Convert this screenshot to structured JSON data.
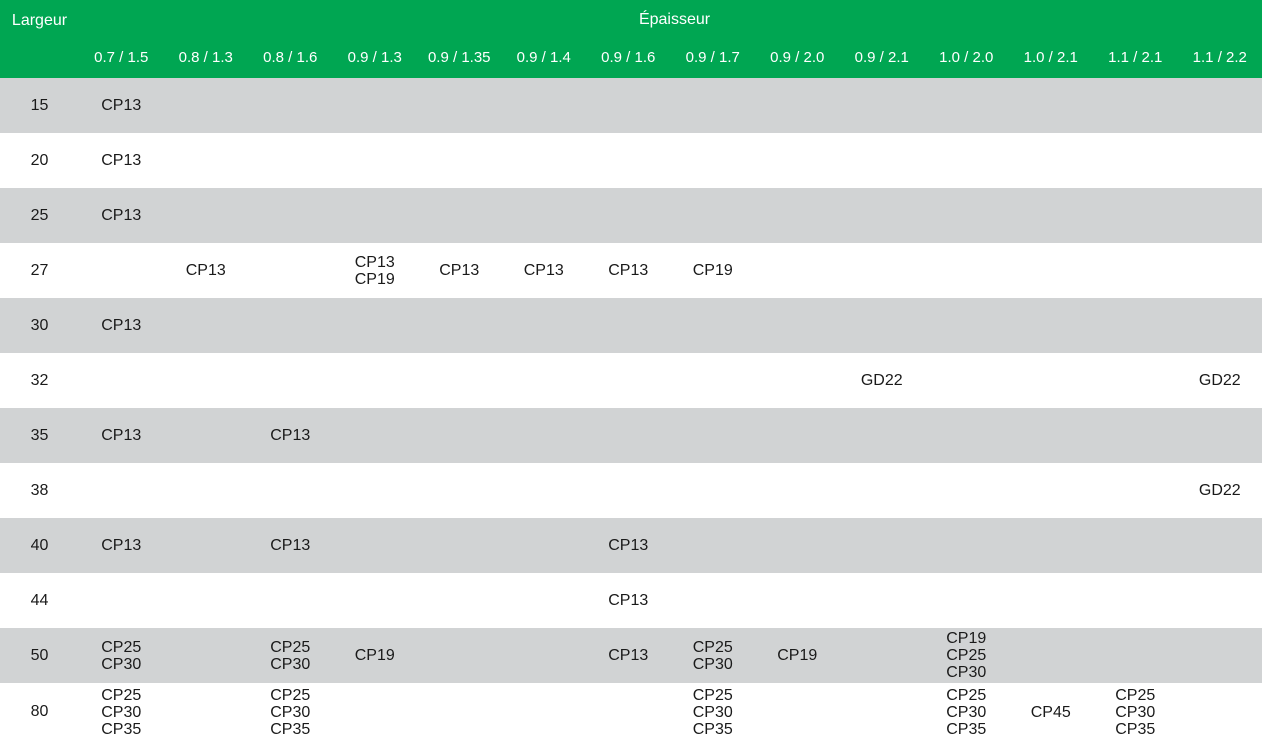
{
  "header": {
    "largeur_label": "Largeur",
    "epaisseur_label": "Épaisseur",
    "thickness_columns": [
      "0.7 / 1.5",
      "0.8 / 1.3",
      "0.8 / 1.6",
      "0.9 / 1.3",
      "0.9 / 1.35",
      "0.9 / 1.4",
      "0.9 / 1.6",
      "0.9 / 1.7",
      "0.9 / 2.0",
      "0.9 / 2.1",
      "1.0 / 2.0",
      "1.0 / 2.1",
      "1.1 / 2.1",
      "1.1 / 2.2"
    ]
  },
  "rows": [
    {
      "width": "15",
      "cells": [
        [
          "CP13"
        ],
        [],
        [],
        [],
        [],
        [],
        [],
        [],
        [],
        [],
        [],
        [],
        [],
        []
      ]
    },
    {
      "width": "20",
      "cells": [
        [
          "CP13"
        ],
        [],
        [],
        [],
        [],
        [],
        [],
        [],
        [],
        [],
        [],
        [],
        [],
        []
      ]
    },
    {
      "width": "25",
      "cells": [
        [
          "CP13"
        ],
        [],
        [],
        [],
        [],
        [],
        [],
        [],
        [],
        [],
        [],
        [],
        [],
        []
      ]
    },
    {
      "width": "27",
      "cells": [
        [],
        [
          "CP13"
        ],
        [],
        [
          "CP13",
          "CP19"
        ],
        [
          "CP13"
        ],
        [
          "CP13"
        ],
        [
          "CP13"
        ],
        [
          "CP19"
        ],
        [],
        [],
        [],
        [],
        [],
        []
      ]
    },
    {
      "width": "30",
      "cells": [
        [
          "CP13"
        ],
        [],
        [],
        [],
        [],
        [],
        [],
        [],
        [],
        [],
        [],
        [],
        [],
        []
      ]
    },
    {
      "width": "32",
      "cells": [
        [],
        [],
        [],
        [],
        [],
        [],
        [],
        [],
        [],
        [
          "GD22"
        ],
        [],
        [],
        [],
        [
          "GD22"
        ]
      ]
    },
    {
      "width": "35",
      "cells": [
        [
          "CP13"
        ],
        [],
        [
          "CP13"
        ],
        [],
        [],
        [],
        [],
        [],
        [],
        [],
        [],
        [],
        [],
        []
      ]
    },
    {
      "width": "38",
      "cells": [
        [],
        [],
        [],
        [],
        [],
        [],
        [],
        [],
        [],
        [],
        [],
        [],
        [],
        [
          "GD22"
        ]
      ]
    },
    {
      "width": "40",
      "cells": [
        [
          "CP13"
        ],
        [],
        [
          "CP13"
        ],
        [],
        [],
        [],
        [
          "CP13"
        ],
        [],
        [],
        [],
        [],
        [],
        [],
        []
      ]
    },
    {
      "width": "44",
      "cells": [
        [],
        [],
        [],
        [],
        [],
        [],
        [
          "CP13"
        ],
        [],
        [],
        [],
        [],
        [],
        [],
        []
      ]
    },
    {
      "width": "50",
      "cells": [
        [
          "CP25",
          "CP30"
        ],
        [],
        [
          "CP25",
          "CP30"
        ],
        [
          "CP19"
        ],
        [],
        [],
        [
          "CP13"
        ],
        [
          "CP25",
          "CP30"
        ],
        [
          "CP19"
        ],
        [],
        [
          "CP19",
          "CP25",
          "CP30"
        ],
        [],
        [],
        []
      ]
    },
    {
      "width": "80",
      "cells": [
        [
          "CP25",
          "CP30",
          "CP35"
        ],
        [],
        [
          "CP25",
          "CP30",
          "CP35"
        ],
        [],
        [],
        [],
        [],
        [
          "CP25",
          "CP30",
          "CP35"
        ],
        [],
        [],
        [
          "CP25",
          "CP30",
          "CP35"
        ],
        [
          "CP45"
        ],
        [
          "CP25",
          "CP30",
          "CP35"
        ],
        []
      ]
    }
  ]
}
